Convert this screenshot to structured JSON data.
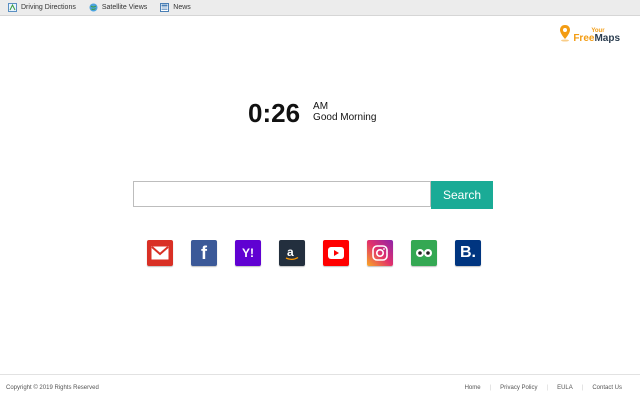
{
  "toolbar": {
    "items": [
      {
        "label": "Driving Directions",
        "icon": "directions-icon"
      },
      {
        "label": "Satellite Views",
        "icon": "globe-icon"
      },
      {
        "label": "News",
        "icon": "news-icon"
      }
    ]
  },
  "logo": {
    "your": "Your",
    "free": "Free",
    "maps": "Maps"
  },
  "clock": {
    "time": "0:26",
    "ampm": "AM",
    "greeting": "Good Morning"
  },
  "search": {
    "placeholder": "",
    "value": "",
    "button_label": "Search"
  },
  "shortcuts": [
    {
      "name": "gmail",
      "color": "#d93025"
    },
    {
      "name": "facebook",
      "color": "#3b5998"
    },
    {
      "name": "yahoo",
      "color": "#6001d2"
    },
    {
      "name": "amazon",
      "color": "#232f3e"
    },
    {
      "name": "youtube",
      "color": "#ff0000"
    },
    {
      "name": "instagram",
      "color": "#c13584"
    },
    {
      "name": "tripadvisor",
      "color": "#34a853"
    },
    {
      "name": "booking",
      "color": "#003580"
    }
  ],
  "footer": {
    "copyright": "Copyright © 2019 Rights Reserved",
    "links": [
      "Home",
      "Privacy Policy",
      "EULA",
      "Contact Us"
    ]
  }
}
